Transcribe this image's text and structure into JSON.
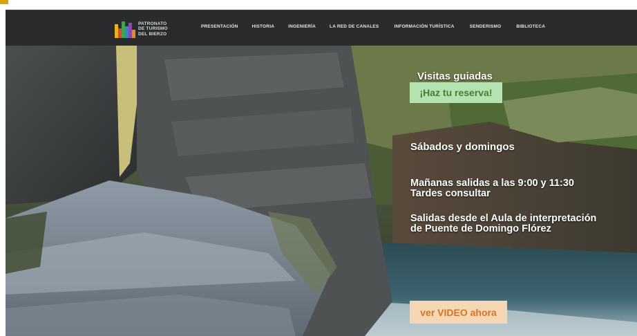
{
  "header": {
    "logo_lines": [
      "PATRONATO",
      "DE TURISMO",
      "DEL BIERZO"
    ],
    "nav": [
      {
        "label": "PRESENTACIÓN"
      },
      {
        "label": "HISTORIA"
      },
      {
        "label": "INGENIERÍA"
      },
      {
        "label": "LA RED DE CANALES"
      },
      {
        "label": "INFORMACIÓN TURÍSTICA"
      },
      {
        "label": "SENDERISMO"
      },
      {
        "label": "BIBLIOTECA"
      }
    ]
  },
  "hero": {
    "visitas": "Visitas guiadas",
    "reserva_button": "¡Haz tu reserva!",
    "dias": "Sábados y domingos",
    "horario_1": "Mañanas salidas a las 9:00 y 11:30",
    "horario_2": "Tardes consultar",
    "salidas_1": "Salidas desde el Aula de interpretación",
    "salidas_2": "de Puente de Domingo Flórez",
    "video_button": "ver VIDEO ahora"
  },
  "colors": {
    "header_bg": "#2a2b2c",
    "reserva_bg": "#b5e3b0",
    "reserva_text": "#4a7a3a",
    "video_bg": "#f6d6b3",
    "video_text": "#d4742a",
    "accent": "#d9a400"
  }
}
